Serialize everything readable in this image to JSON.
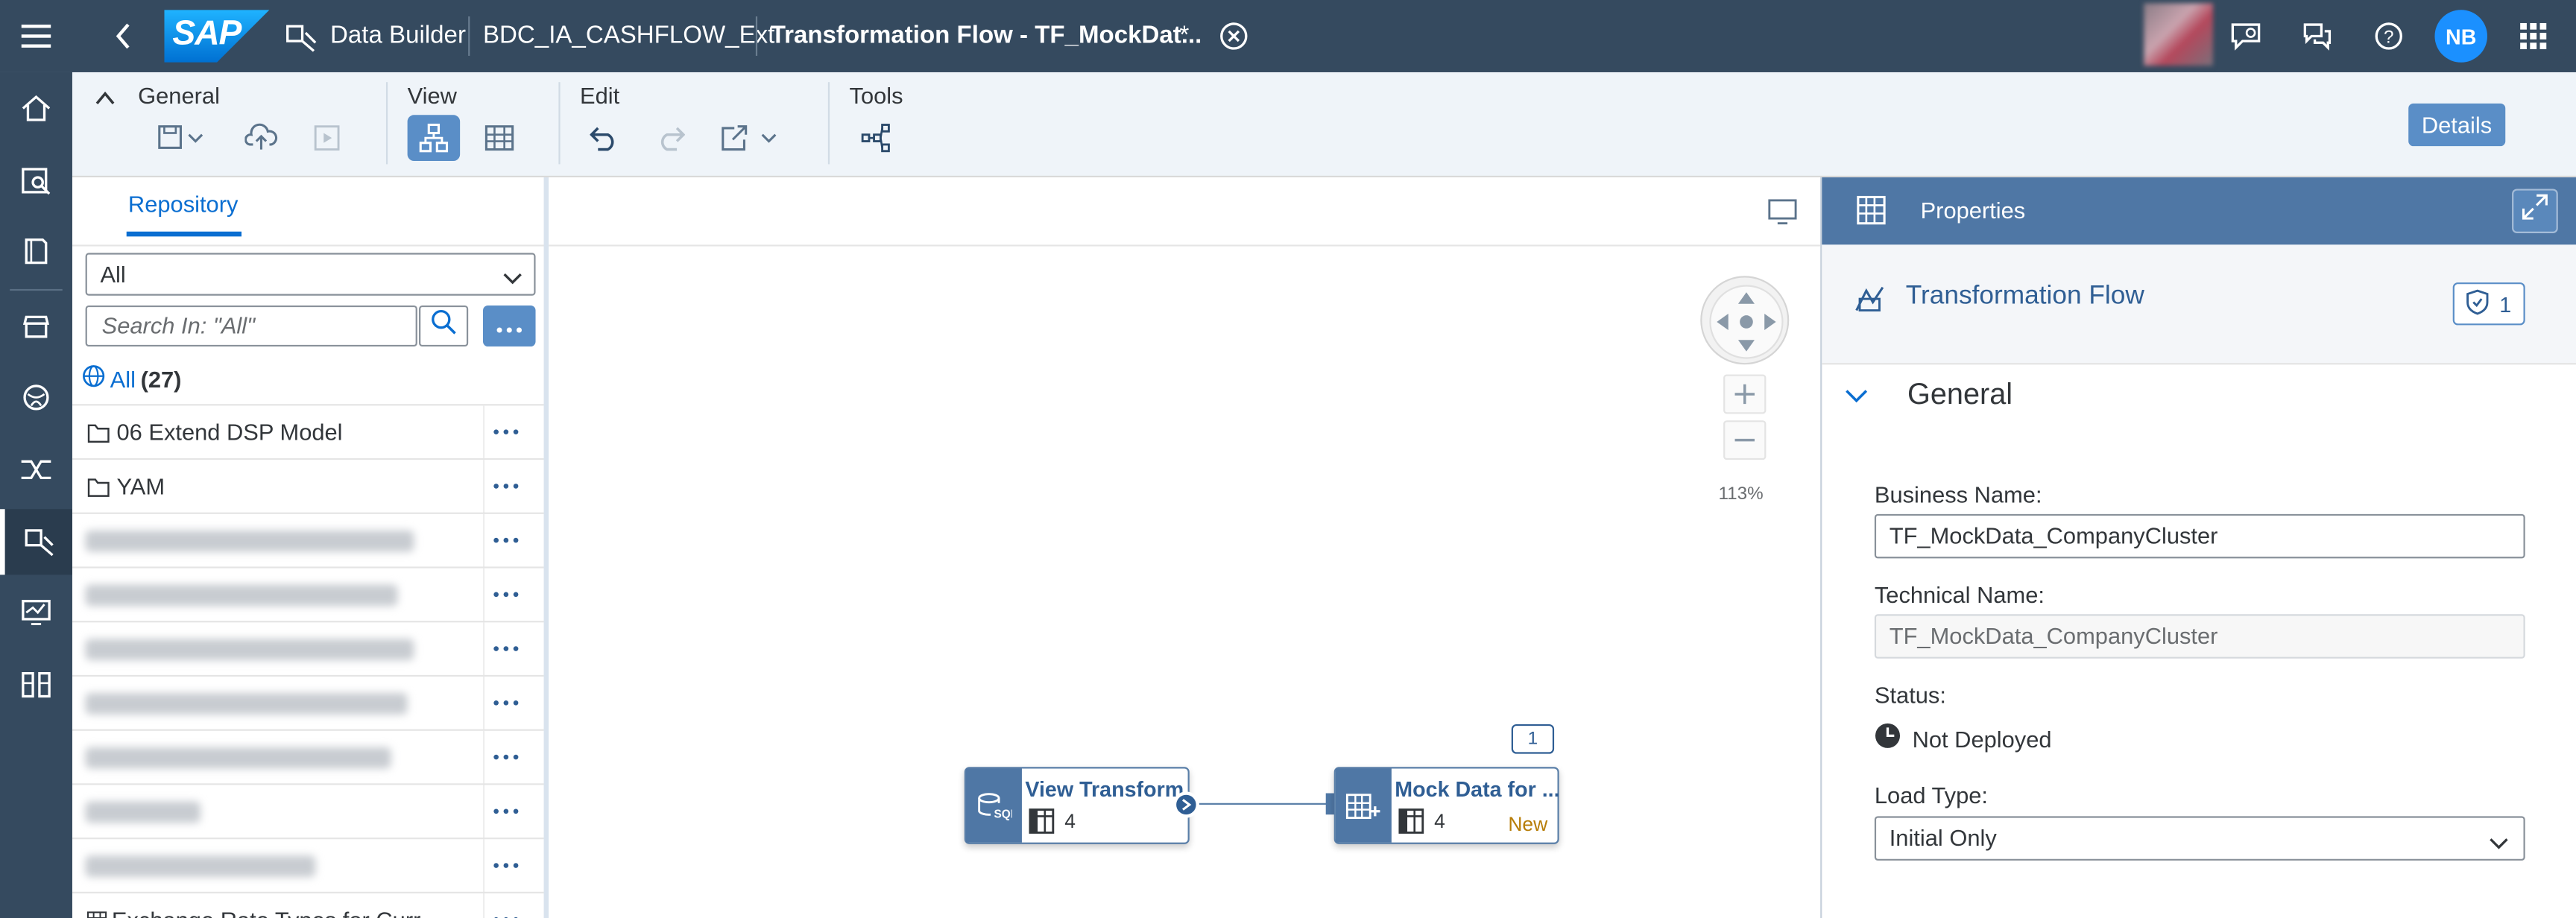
{
  "shell": {
    "logo": "SAP",
    "app_name": "Data Builder",
    "space_name": "BDC_IA_CASHFLOW_Ext",
    "tab_title": "Transformation Flow - TF_MockDat...",
    "unsaved_marker": "*",
    "avatar_initials": "NB"
  },
  "toolbar": {
    "general_label": "General",
    "view_label": "View",
    "edit_label": "Edit",
    "tools_label": "Tools",
    "details_label": "Details"
  },
  "repository": {
    "tab_label": "Repository",
    "filter_value": "All",
    "search_placeholder": "Search In: \"All\"",
    "all_link": "All",
    "all_count": "(27)",
    "items": [
      {
        "type": "folder",
        "label": "06 Extend DSP Model"
      },
      {
        "type": "folder",
        "label": "YAM"
      },
      {
        "type": "hidden",
        "label": ""
      },
      {
        "type": "hidden",
        "label": ""
      },
      {
        "type": "hidden",
        "label": ""
      },
      {
        "type": "hidden",
        "label": ""
      },
      {
        "type": "hidden",
        "label": ""
      },
      {
        "type": "hidden",
        "label": ""
      },
      {
        "type": "hidden",
        "label": ""
      },
      {
        "type": "table",
        "label": "Exchange Rate Types for Curr..."
      }
    ]
  },
  "canvas": {
    "zoom_level": "113%",
    "nodes": [
      {
        "title": "View Transform",
        "column_count": "4",
        "status": ""
      },
      {
        "title": "Mock Data for ...",
        "column_count": "4",
        "status": "New"
      }
    ],
    "target_badge": "1"
  },
  "properties": {
    "header_title": "Properties",
    "object_type": "Transformation Flow",
    "validation_count": "1",
    "section_title": "General",
    "business_name_label": "Business Name:",
    "business_name_value": "TF_MockData_CompanyCluster",
    "technical_name_label": "Technical Name:",
    "technical_name_value": "TF_MockData_CompanyCluster",
    "status_label": "Status:",
    "status_value": "Not Deployed",
    "load_type_label": "Load Type:",
    "load_type_value": "Initial Only"
  }
}
